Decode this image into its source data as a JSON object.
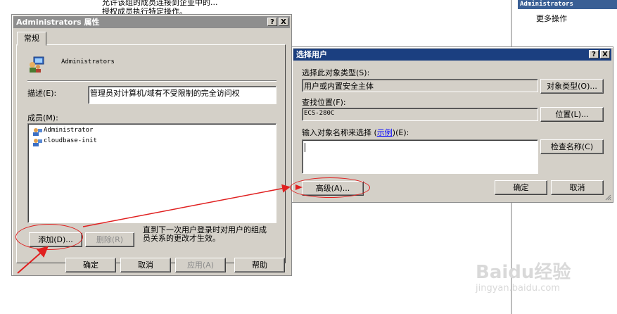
{
  "background": {
    "top_text_1": "允许该组的成员连接到企业中的...",
    "top_text_2": "授权成员执行特定操作。"
  },
  "right_pane": {
    "header": "Administrators",
    "item": "更多操作"
  },
  "props_dialog": {
    "title": "Administrators 属性",
    "help": "?",
    "close": "X",
    "tab": "常规",
    "group_name": "Administrators",
    "desc_label": "描述(E):",
    "desc_value": "管理员对计算机/域有不受限制的完全访问权",
    "members_label": "成员(M):",
    "members": [
      "Administrator",
      "cloudbase-init"
    ],
    "add_button": "添加(D)...",
    "remove_button": "删除(R)",
    "note": "直到下一次用户登录时对用户的组成员关系的更改才生效。",
    "ok": "确定",
    "cancel": "取消",
    "apply": "应用(A)",
    "help_button": "帮助"
  },
  "select_dialog": {
    "title": "选择用户",
    "help": "?",
    "close": "X",
    "type_label": "选择此对象类型(S):",
    "type_value": "用户或内置安全主体",
    "type_button": "对象类型(O)...",
    "loc_label": "查找位置(F):",
    "loc_value": "ECS-280C",
    "loc_button": "位置(L)...",
    "input_label_pre": "输入对象名称来选择 (",
    "input_label_link": "示例",
    "input_label_post": ")(E):",
    "check_button": "检查名称(C)",
    "advanced_button": "高级(A)...",
    "ok": "确定",
    "cancel": "取消"
  },
  "watermark": {
    "brand": "Baidu经验",
    "url": "jingyan.baidu.com"
  },
  "colors": {
    "annotation_red": "#e02020",
    "title_active": "#1b3f80",
    "title_inactive": "#8e8e8e",
    "dialog_face": "#d4d0c8"
  }
}
